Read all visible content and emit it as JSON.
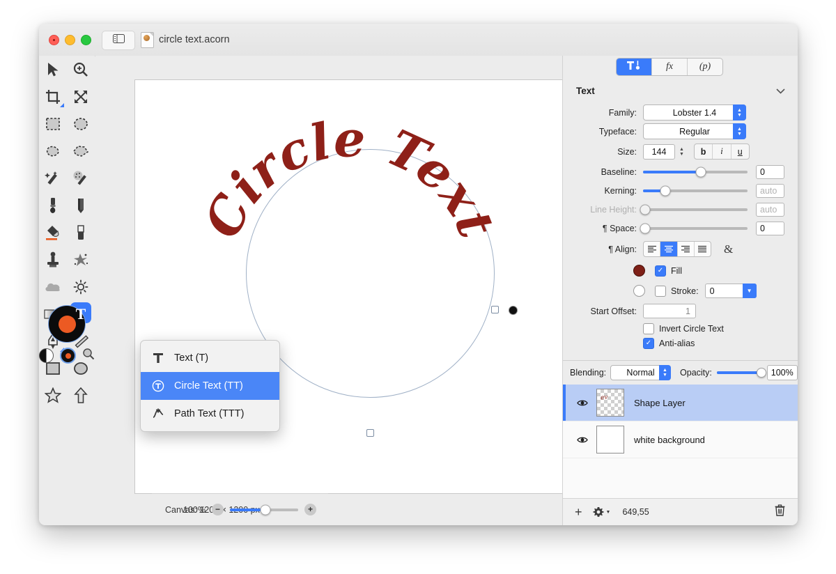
{
  "window": {
    "document_title": "circle text.acorn",
    "traffic_lights": [
      "close",
      "minimize",
      "zoom"
    ],
    "sidebar_toggle_icon": "sidebar-icon"
  },
  "toolbox": {
    "tools": [
      {
        "name": "move-tool",
        "icon": "arrow-cursor-icon"
      },
      {
        "name": "zoom-tool",
        "icon": "magnifier-plus-icon"
      },
      {
        "name": "crop-tool",
        "icon": "crop-icon"
      },
      {
        "name": "transform-tool",
        "icon": "arrows-expand-icon"
      },
      {
        "name": "rectangle-select-tool",
        "icon": "dashed-rectangle-icon"
      },
      {
        "name": "ellipse-select-tool",
        "icon": "dashed-ellipse-icon"
      },
      {
        "name": "lasso-tool",
        "icon": "lasso-icon"
      },
      {
        "name": "polygon-lasso-tool",
        "icon": "polygon-lasso-icon"
      },
      {
        "name": "magic-wand-tool",
        "icon": "magic-wand-icon"
      },
      {
        "name": "select-similar-tool",
        "icon": "dotted-wand-icon"
      },
      {
        "name": "brush-tool",
        "icon": "brush-icon"
      },
      {
        "name": "pencil-tool",
        "icon": "pencil-icon"
      },
      {
        "name": "paint-bucket-tool",
        "icon": "paint-bucket-icon"
      },
      {
        "name": "eraser-tool",
        "icon": "eraser-icon"
      },
      {
        "name": "clone-stamp-tool",
        "icon": "clone-stamp-icon"
      },
      {
        "name": "smudge-tool",
        "icon": "smudge-icon"
      },
      {
        "name": "dodge-tool",
        "icon": "cloud-icon"
      },
      {
        "name": "burn-tool",
        "icon": "sun-icon"
      },
      {
        "name": "gradient-tool",
        "icon": "gradient-icon"
      },
      {
        "name": "text-tool",
        "icon": "text-T-icon",
        "active": true
      },
      {
        "name": "bezier-pen-tool",
        "icon": "pen-nib-icon"
      },
      {
        "name": "line-tool",
        "icon": "line-icon"
      },
      {
        "name": "rectangle-shape-tool",
        "icon": "rectangle-icon"
      },
      {
        "name": "ellipse-shape-tool",
        "icon": "ellipse-icon"
      },
      {
        "name": "star-shape-tool",
        "icon": "star-icon"
      },
      {
        "name": "arrow-shape-tool",
        "icon": "arrow-shape-icon"
      }
    ],
    "color_wells": {
      "foreground": "#ec5a23",
      "background": "#0b0b0b",
      "bw_reset_icon": "black-white-circle-icon",
      "swap_icon": "selected-color-icon",
      "picker_icon": "magnifier-icon"
    }
  },
  "tool_menu": {
    "items": [
      {
        "label": "Text (T)",
        "icon": "text-T-icon",
        "selected": false
      },
      {
        "label": "Circle Text (TT)",
        "icon": "circle-text-icon",
        "selected": true
      },
      {
        "label": "Path Text (TTT)",
        "icon": "path-text-icon",
        "selected": false
      }
    ]
  },
  "canvas": {
    "artwork_text": "Circle Text",
    "artwork_color": "#8e2018",
    "guide_color": "#9fb0c6"
  },
  "statusbar": {
    "canvas_info": "Canvas: 1200 × 1200 px",
    "zoom_percent": "100%",
    "zoom_out_icon": "minus-circle-icon",
    "zoom_in_icon": "plus-circle-icon"
  },
  "inspector": {
    "segments": [
      {
        "label": "",
        "icon": "tools-hammer-icon",
        "active": true
      },
      {
        "label": "fx",
        "icon": "fx-icon",
        "active": false
      },
      {
        "label": "(p)",
        "icon": "paragraph-p-icon",
        "active": false
      }
    ],
    "panel_title": "Text",
    "collapse_icon": "chevron-down-icon",
    "fields": {
      "family_label": "Family:",
      "family_value": "Lobster 1.4",
      "typeface_label": "Typeface:",
      "typeface_value": "Regular",
      "size_label": "Size:",
      "size_value": "144",
      "bold_label": "b",
      "italic_label": "i",
      "underline_label": "u",
      "baseline_label": "Baseline:",
      "baseline_value": "0",
      "kerning_label": "Kerning:",
      "kerning_value": "auto",
      "line_height_label": "Line Height:",
      "line_height_value": "auto",
      "space_label": "¶ Space:",
      "space_value": "0",
      "align_label": "¶ Align:",
      "align_options": [
        "align-left",
        "align-center",
        "align-right",
        "align-justify"
      ],
      "align_selected": "align-center",
      "ampersand_label": "&",
      "fill_label": "Fill",
      "fill_color": "#7e2017",
      "stroke_label": "Stroke:",
      "stroke_value": "0",
      "start_offset_label": "Start Offset:",
      "start_offset_value": "1",
      "invert_circle_text_label": "Invert Circle Text",
      "anti_alias_label": "Anti-alias"
    }
  },
  "layers": {
    "blending_label": "Blending:",
    "blending_value": "Normal",
    "opacity_label": "Opacity:",
    "opacity_value": "100%",
    "items": [
      {
        "name": "Shape Layer",
        "selected": true,
        "visible": true,
        "thumb": "checkerboard-text-thumb"
      },
      {
        "name": "white background",
        "selected": false,
        "visible": true,
        "thumb": "white-thumb"
      }
    ],
    "toolbar": {
      "add_icon": "plus-icon",
      "settings_icon": "gear-icon",
      "coordinates": "649,55",
      "delete_icon": "trash-icon"
    }
  }
}
